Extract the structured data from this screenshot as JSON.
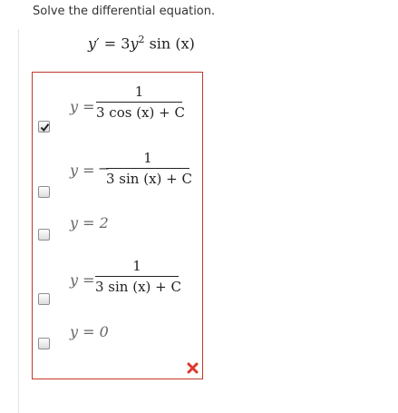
{
  "question": {
    "prompt": "Solve the differential equation.",
    "equation": {
      "lhs": "y′",
      "equals": "=",
      "coef": "3",
      "var": "y",
      "exp": "2",
      "func": "sin",
      "arg": "(x)"
    }
  },
  "options": [
    {
      "lhs": "y =",
      "sign": "",
      "numerator": "1",
      "denominator": "3 cos (x) + C",
      "expression": "",
      "checked": true
    },
    {
      "lhs": "y =",
      "sign": "−",
      "numerator": "1",
      "denominator": "3 sin (x) + C",
      "expression": "",
      "checked": false
    },
    {
      "lhs": "",
      "sign": "",
      "numerator": "",
      "denominator": "",
      "expression": "y = 2",
      "checked": false
    },
    {
      "lhs": "y =",
      "sign": "",
      "numerator": "1",
      "denominator": "3 sin (x) + C",
      "expression": "",
      "checked": false
    },
    {
      "lhs": "",
      "sign": "",
      "numerator": "",
      "denominator": "",
      "expression": "y = 0",
      "checked": false
    }
  ],
  "result": {
    "status": "incorrect",
    "icon": "cross-icon",
    "color": "#e0362c"
  },
  "colors": {
    "box_border": "#c0392b"
  }
}
